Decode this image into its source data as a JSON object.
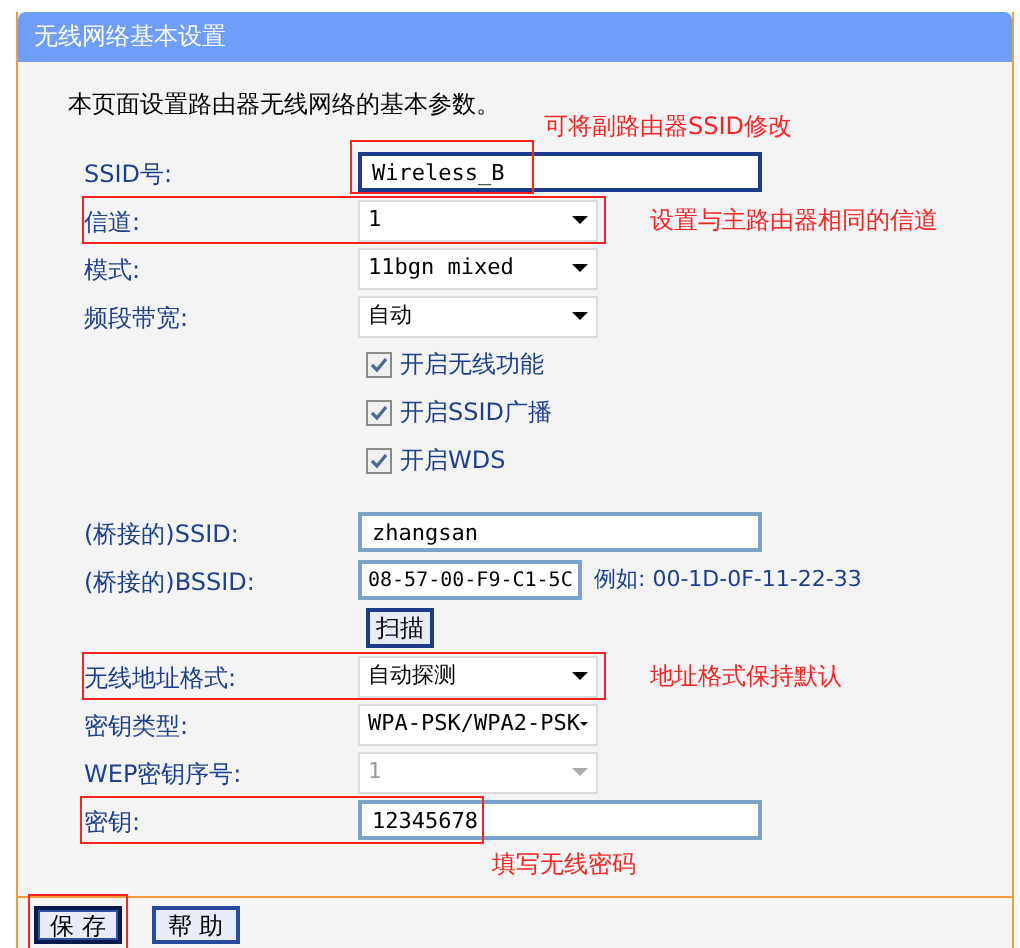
{
  "window": {
    "title": "无线网络基本设置"
  },
  "intro": "本页面设置路由器无线网络的基本参数。",
  "fields": [
    {
      "kind": "text",
      "label": "SSID号:",
      "value": "Wireless_B",
      "focused": true,
      "highlighted": true,
      "frame_label": false,
      "note": "可将副路由器SSID修改"
    },
    {
      "kind": "select",
      "label": "信道:",
      "value": "1",
      "highlighted": true,
      "frame_label": true,
      "note": "设置与主路由器相同的信道"
    },
    {
      "kind": "select",
      "label": "模式:",
      "value": "11bgn mixed"
    },
    {
      "kind": "select",
      "label": "频段带宽:",
      "value": "自动"
    },
    {
      "kind": "checkbox",
      "label": "开启无线功能",
      "checked": true
    },
    {
      "kind": "checkbox",
      "label": "开启SSID广播",
      "checked": true
    },
    {
      "kind": "checkbox",
      "label": "开启WDS",
      "checked": true
    },
    {
      "kind": "text",
      "label": "(桥接的)SSID:",
      "value": "zhangsan"
    },
    {
      "kind": "text",
      "label": "(桥接的)BSSID:",
      "value": "08-57-00-F9-C1-5C",
      "hint": "例如: 00-1D-0F-11-22-33"
    },
    {
      "kind": "button",
      "label": "扫描"
    },
    {
      "kind": "select",
      "label": "无线地址格式:",
      "value": "自动探测",
      "highlighted": true,
      "frame_label": true,
      "note": "地址格式保持默认"
    },
    {
      "kind": "select",
      "label": "密钥类型:",
      "value": "WPA-PSK/WPA2-PSK"
    },
    {
      "kind": "select",
      "label": "WEP密钥序号:",
      "value": "1",
      "disabled": true
    },
    {
      "kind": "text",
      "label": "密钥:",
      "value": "12345678",
      "highlighted": true,
      "frame_label": true,
      "note": "填写无线密码"
    }
  ],
  "buttons": [
    {
      "label": "保 存",
      "default": true,
      "highlight": true
    },
    {
      "label": "帮 助",
      "default": false,
      "highlight": false
    }
  ]
}
